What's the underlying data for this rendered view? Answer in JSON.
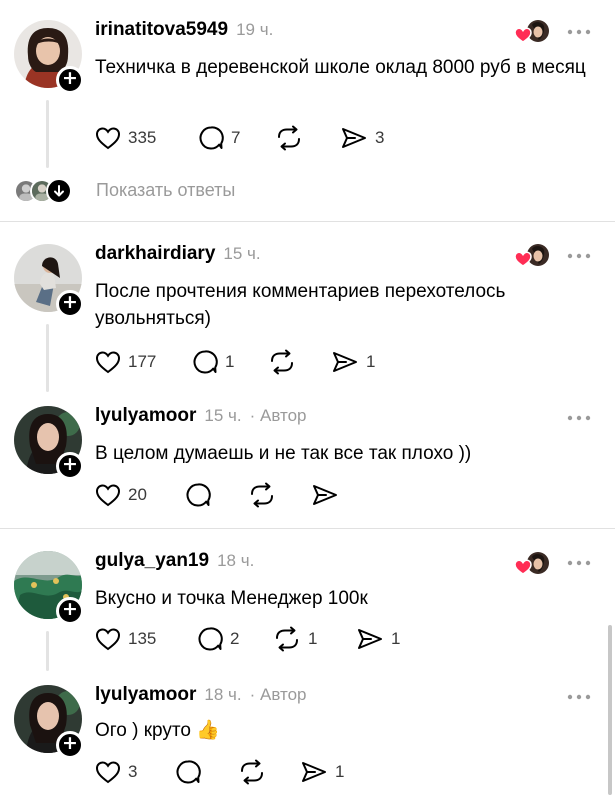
{
  "replies_label": "Показать ответы",
  "posts": [
    {
      "username": "irinatitova5949",
      "time": "19 ч.",
      "author_tag": "",
      "text": "Техничка в деревенской школе оклад  8000 руб в месяц",
      "likes": "335",
      "comments": "7",
      "reposts": "",
      "shares": "3",
      "liked_by_author": true
    },
    {
      "username": "darkhairdiary",
      "time": "15 ч.",
      "author_tag": "",
      "text": "После прочтения комментариев перехотелось увольняться)",
      "likes": "177",
      "comments": "1",
      "reposts": "",
      "shares": "1",
      "liked_by_author": true
    },
    {
      "username": "lyulyamoor",
      "time": "15 ч.",
      "author_tag": "· Автор",
      "text": "В целом думаешь и не так все так плохо ))",
      "likes": "20",
      "comments": "",
      "reposts": "",
      "shares": "",
      "liked_by_author": false
    },
    {
      "username": "gulya_yan19",
      "time": "18 ч.",
      "author_tag": "",
      "text": "Вкусно и точка Менеджер 100к",
      "likes": "135",
      "comments": "2",
      "reposts": "1",
      "shares": "1",
      "liked_by_author": true
    },
    {
      "username": "lyulyamoor",
      "time": "18 ч.",
      "author_tag": "· Автор",
      "text": "Ого ) круто 👍",
      "likes": "3",
      "comments": "",
      "reposts": "",
      "shares": "1",
      "liked_by_author": false
    }
  ],
  "colors": {
    "heart": "#ff2d55",
    "secondary_text": "#9a9a9a",
    "divider": "#e1e1e1"
  }
}
